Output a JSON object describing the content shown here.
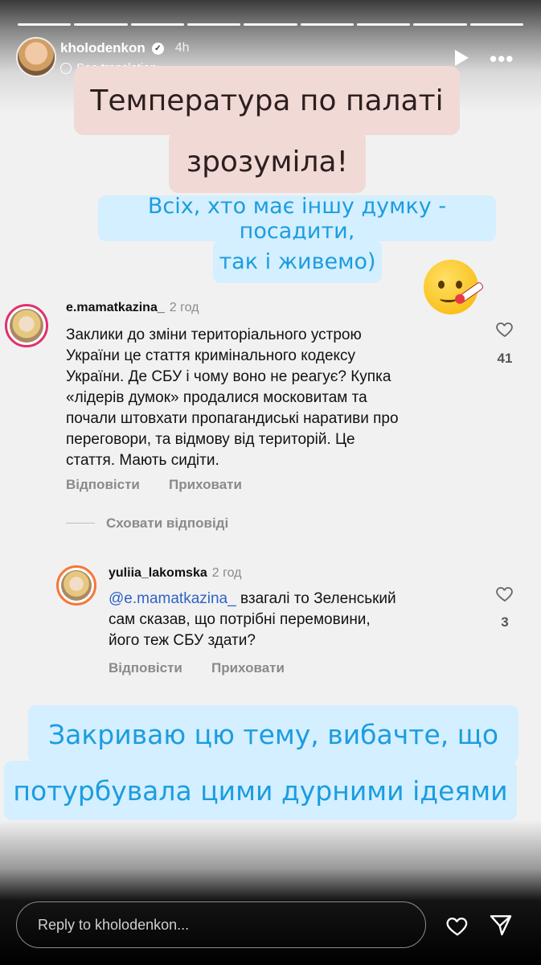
{
  "header": {
    "username": "kholodenkon",
    "time": "4h",
    "see_translation": "See translation",
    "progress_segments": 9
  },
  "stickers": {
    "title_line1": "Температура по палаті",
    "title_line2": "зрозуміла!",
    "sub_line1": "Всіх, хто має іншу думку - посадити,",
    "sub_line2": "так і живемо)",
    "bottom_line1": "Закриваю цю тему, вибачте, що",
    "bottom_line2": "потурбувала цими дурними ідеями"
  },
  "comments": [
    {
      "username": "e.mamatkazina_",
      "time": "2 год",
      "lines": [
        "Заклики до зміни територіального устрою",
        "України це стаття кримінального кодексу",
        "України. Де СБУ і чому воно не реагує? Купка",
        "«лідерів думок» продалися московитам та",
        "почали штовхати пропагандиські наративи про",
        "переговори, та відмову від територій. Це",
        "стаття. Мають сидіти."
      ],
      "likes": "41",
      "reply_label": "Відповісти",
      "hide_label": "Приховати"
    },
    {
      "username": "yuliia_lakomska",
      "time": "2 год",
      "mention": "@e.mamatkazina_",
      "lines": [
        " взагалі то Зеленський",
        "сам сказав, що потрібні перемовини,",
        "його теж СБУ здати?"
      ],
      "likes": "3",
      "reply_label": "Відповісти",
      "hide_label": "Приховати"
    }
  ],
  "hide_replies": "Сховати відповіді",
  "footer": {
    "reply_placeholder": "Reply to kholodenkon..."
  }
}
